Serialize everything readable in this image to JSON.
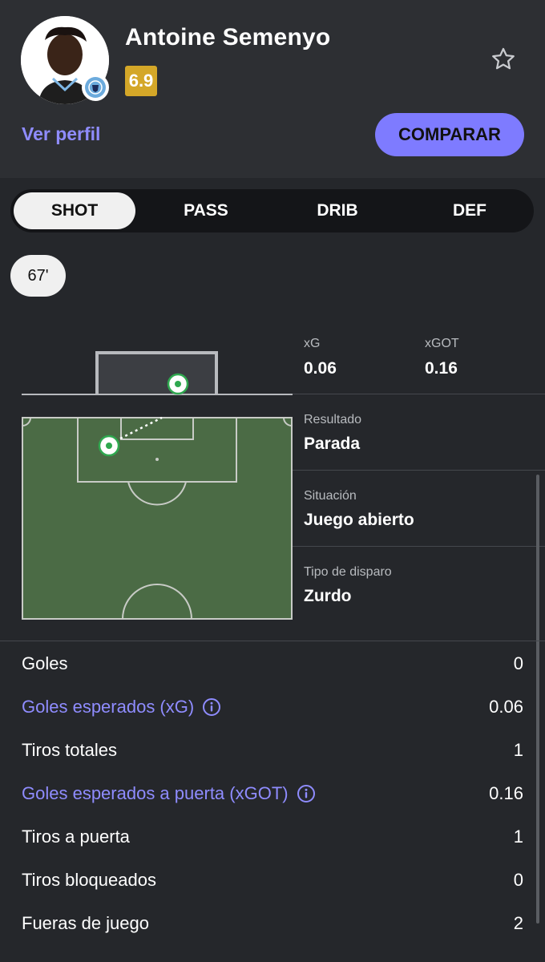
{
  "player": {
    "name": "Antoine Semenyo",
    "rating": "6.9",
    "view_profile": "Ver perfil",
    "compare": "COMPARAR"
  },
  "tabs": [
    {
      "label": "SHOT",
      "active": true
    },
    {
      "label": "PASS",
      "active": false
    },
    {
      "label": "DRIB",
      "active": false
    },
    {
      "label": "DEF",
      "active": false
    }
  ],
  "shot": {
    "minute": "67'",
    "xg_label": "xG",
    "xg_value": "0.06",
    "xgot_label": "xGOT",
    "xgot_value": "0.16",
    "result_label": "Resultado",
    "result_value": "Parada",
    "situation_label": "Situación",
    "situation_value": "Juego abierto",
    "shot_type_label": "Tipo de disparo",
    "shot_type_value": "Zurdo"
  },
  "stats": [
    {
      "label": "Goles",
      "value": "0",
      "link": false
    },
    {
      "label": "Goles esperados (xG)",
      "value": "0.06",
      "link": true
    },
    {
      "label": "Tiros totales",
      "value": "1",
      "link": false
    },
    {
      "label": "Goles esperados a puerta (xGOT)",
      "value": "0.16",
      "link": true
    },
    {
      "label": "Tiros a puerta",
      "value": "1",
      "link": false
    },
    {
      "label": "Tiros bloqueados",
      "value": "0",
      "link": false
    },
    {
      "label": "Fueras de juego",
      "value": "2",
      "link": false
    }
  ],
  "icons": {
    "star": "star-icon",
    "info": "info-icon",
    "club": "manchester-city-badge"
  },
  "colors": {
    "accent": "#7e7bff",
    "link": "#8f8cff",
    "rating": "#d4a728",
    "pitch": "#4b6b45",
    "shot_marker": "#2fa84f"
  }
}
